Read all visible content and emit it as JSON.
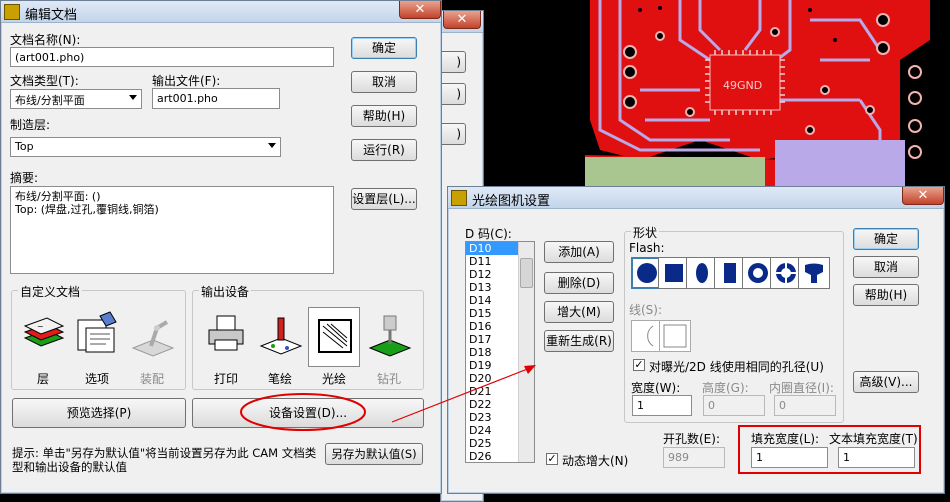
{
  "colors": {
    "accent": "#3c7fb1",
    "annotation_red": "#e00000",
    "pcb_copper": "#e01010",
    "pcb_silk": "#b9a9e8"
  },
  "pcb": {
    "chip_label": "49GND"
  },
  "edit_dialog": {
    "title": "编辑文档",
    "close_label": "✕",
    "doc_name_label": "文档名称(N):",
    "doc_name_value": "(art001.pho)",
    "doc_type_label": "文档类型(T):",
    "doc_type_value": "布线/分割平面",
    "output_file_label": "输出文件(F):",
    "output_file_value": "art001.pho",
    "layer_label": "制造层:",
    "layer_value": "Top",
    "summary_label": "摘要:",
    "summary_line1": "布线/分割平面: ()",
    "summary_line2": "Top: (焊盘,过孔,覆铜线,铜箔)",
    "ok": "确定",
    "cancel": "取消",
    "help": "帮助(H)",
    "run": "运行(R)",
    "layers": "设置层(L)...",
    "custom_group": "自定义文档",
    "output_group": "输出设备",
    "custom_items": [
      {
        "label": "层"
      },
      {
        "label": "选项"
      },
      {
        "label": "装配"
      }
    ],
    "device_items": [
      {
        "label": "打印"
      },
      {
        "label": "笔绘"
      },
      {
        "label": "光绘"
      },
      {
        "label": "钻孔"
      }
    ],
    "preview": "预览选择(P)",
    "device_setup": "设备设置(D)...",
    "hint": "提示: 单击\"另存为默认值\"将当前设置另存为此 CAM 文档类型和输出设备的默认值",
    "save_default": "另存为默认值(S)"
  },
  "bg_dialog": {
    "close_label": "✕",
    "button_partial": ")"
  },
  "photo_dialog": {
    "title": "光绘图机设置",
    "close_label": "✕",
    "dcode_label": "D 码(C):",
    "dcodes": [
      "D10",
      "D11",
      "D12",
      "D13",
      "D14",
      "D15",
      "D16",
      "D17",
      "D18",
      "D19",
      "D20",
      "D21",
      "D22",
      "D23",
      "D24",
      "D25",
      "D26"
    ],
    "add": "添加(A)",
    "delete": "删除(D)",
    "increase": "增大(M)",
    "regen": "重新生成(R)",
    "shape_group": "形状",
    "flash_label": "Flash:",
    "line_label": "线(S):",
    "same_aperture": "对曝光/2D 线使用相同的孔径(U)",
    "same_aperture_check": "✓",
    "width_label": "宽度(W):",
    "width_value": "1",
    "height_label": "高度(G):",
    "height_value": "0",
    "inner_label": "内圈直径(I):",
    "inner_value": "0",
    "auto_increase": "动态增大(N)",
    "auto_check": "✓",
    "drill_count_label": "开孔数(E):",
    "drill_count_value": "989",
    "fill_width_label": "填充宽度(L):",
    "fill_width_value": "1",
    "text_fill_label": "文本填充宽度(T):",
    "text_fill_value": "1",
    "ok": "确定",
    "cancel": "取消",
    "help": "帮助(H)",
    "advanced": "高级(V)..."
  }
}
